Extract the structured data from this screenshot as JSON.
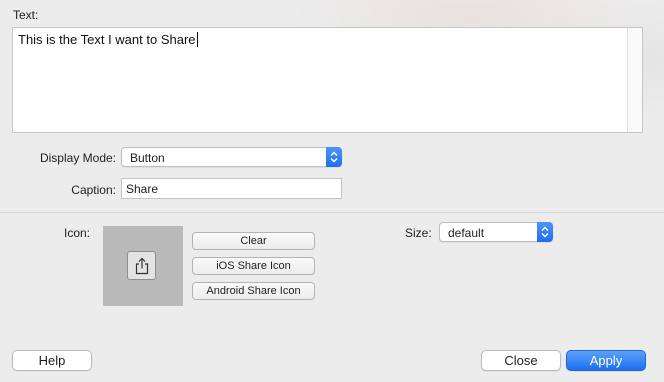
{
  "text_section": {
    "label": "Text:",
    "value": "This is the Text I want to Share"
  },
  "display_mode": {
    "label": "Display Mode:",
    "value": "Button"
  },
  "caption": {
    "label": "Caption:",
    "value": "Share"
  },
  "icon": {
    "label": "Icon:",
    "preview_icon": "share-icon",
    "buttons": {
      "clear": "Clear",
      "ios": "iOS Share Icon",
      "android": "Android Share Icon"
    }
  },
  "size": {
    "label": "Size:",
    "value": "default"
  },
  "footer": {
    "help": "Help",
    "close": "Close",
    "apply": "Apply"
  },
  "colors": {
    "accent": "#1f6ef0",
    "window_bg": "#ececec",
    "icon_well": "#b9b9b9"
  }
}
